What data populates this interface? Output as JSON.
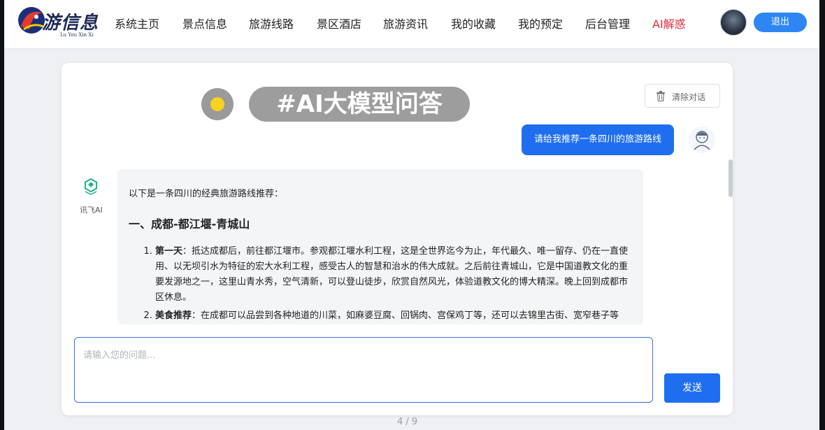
{
  "logo": {
    "title": "游信息",
    "subtitle": "Lu You Xin Xi"
  },
  "nav": {
    "items": [
      {
        "label": "系统主页"
      },
      {
        "label": "景点信息"
      },
      {
        "label": "旅游线路"
      },
      {
        "label": "景区酒店"
      },
      {
        "label": "旅游资讯"
      },
      {
        "label": "我的收藏"
      },
      {
        "label": "我的预定"
      },
      {
        "label": "后台管理"
      },
      {
        "label": "AI解惑",
        "active": true
      }
    ],
    "logout_label": "退出"
  },
  "chat": {
    "title": "#AI大模型问答",
    "clear_label": "清除对话",
    "user_message": "请给我推荐一条四川的旅游路线",
    "ai_name": "讯飞AI",
    "ai_reply": {
      "intro": "以下是一条四川的经典旅游路线推荐：",
      "heading": "一、成都-都江堰-青城山",
      "items": [
        {
          "label": "第一天",
          "text": "：抵达成都后，前往都江堰市。参观都江堰水利工程，这是全世界迄今为止，年代最久、唯一留存、仍在一直使用、以无坝引水为特征的宏大水利工程，感受古人的智慧和治水的伟大成就。之后前往青城山，它是中国道教文化的重要发源地之一，这里山青水秀，空气清新，可以登山徒步，欣赏自然风光，体验道教文化的博大精深。晚上回到成都市区休息。"
        },
        {
          "label": "美食推荐",
          "text": "：在成都可以品尝到各种地道的川菜，如麻婆豆腐、回锅肉、宫保鸡丁等，还可以去锦里古街、宽窄巷子等"
        }
      ]
    },
    "input_placeholder": "请输入您的问题...",
    "send_label": "发送"
  },
  "page_indicator": "4 / 9",
  "colors": {
    "accent": "#1f6ef0",
    "active_nav": "#e02d3c",
    "logout": "#2f86f2"
  }
}
